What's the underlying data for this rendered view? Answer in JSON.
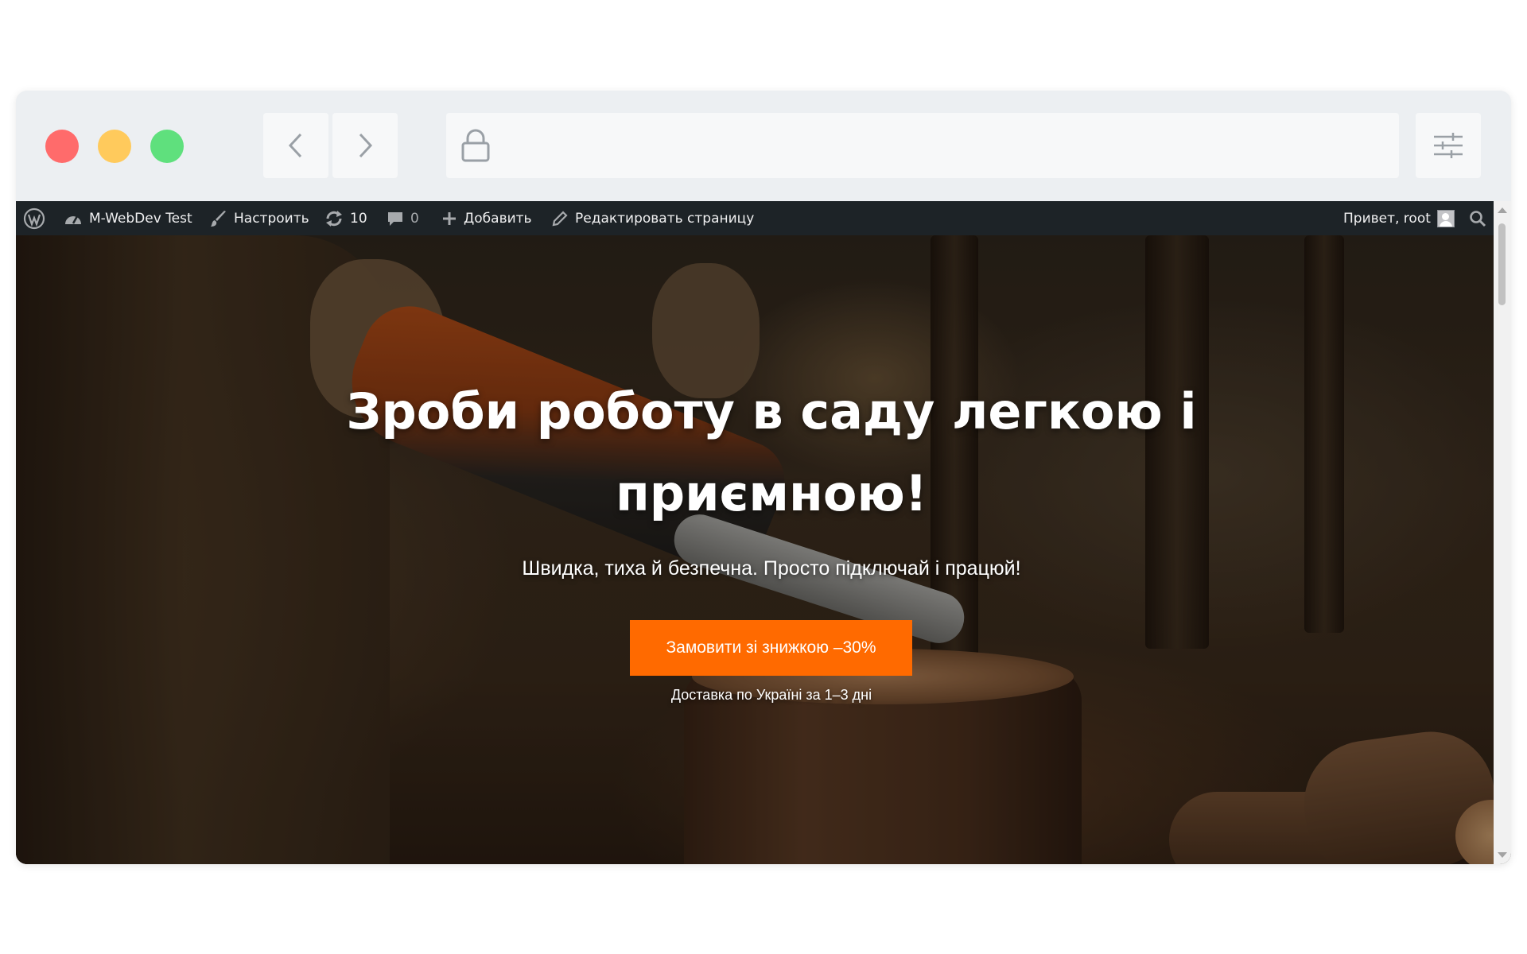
{
  "browser": {
    "window_controls": [
      "close",
      "minimize",
      "maximize"
    ],
    "address_bar": {
      "url": "",
      "icon": "lock-icon"
    },
    "nav": {
      "back_icon": "chevron-left-icon",
      "forward_icon": "chevron-right-icon"
    },
    "menu_icon": "sliders-icon"
  },
  "admin_bar": {
    "wp_logo_icon": "wordpress-icon",
    "site_name": "M-WebDev Test",
    "customize": "Настроить",
    "updates_count": "10",
    "comments_count": "0",
    "new": "Добавить",
    "edit_page": "Редактировать страницу",
    "greeting": "Привет, root",
    "search_icon": "search-icon"
  },
  "hero": {
    "title": "Зроби роботу в саду легкою і приємною!",
    "subtitle": "Швидка, тиха й безпечна. Просто підключай і працюй!",
    "cta_label": "Замовити зі знижкою –30%",
    "delivery_note": "Доставка по Україні за 1–3 дні"
  },
  "colors": {
    "accent": "#ff6a00",
    "admin_bar_bg": "#1d2327",
    "close": "#ff6b6b",
    "minimize": "#ffca5c",
    "maximize": "#5fe07d"
  }
}
